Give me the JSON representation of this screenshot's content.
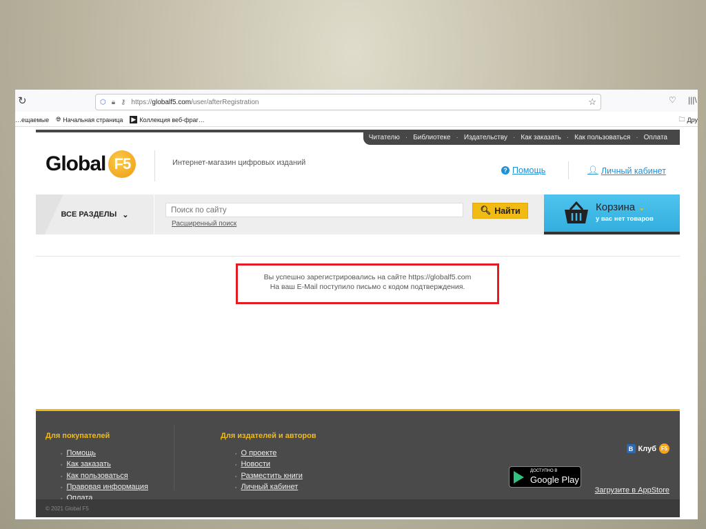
{
  "browser": {
    "url_prefix": "https://",
    "url_domain": "globalf5.com",
    "url_path": "/user/afterRegistration",
    "bookmarks": [
      "…ещаемые",
      "Начальная страница",
      "Коллекция веб-фраг…"
    ],
    "bookmarks_right": "Дру"
  },
  "topnav": [
    "Читателю",
    "Библиотеке",
    "Издательству",
    "Как заказать",
    "Как пользоваться",
    "Оплата"
  ],
  "header": {
    "logo_text": "Global",
    "logo_badge": "F5",
    "tagline": "Интернет-магазин цифровых изданий",
    "help": "Помощь",
    "account": "Личный кабинет"
  },
  "band": {
    "sections": "ВСЕ РАЗДЕЛЫ",
    "search_placeholder": "Поиск по сайту",
    "advanced": "Расширенный поиск",
    "find": "Найти",
    "cart_title": "Корзина",
    "cart_status": "у вас нет товаров"
  },
  "message": {
    "line1": "Вы успешно зарегистрировались на сайте https://globalf5.com",
    "line2": "На ваш E-Mail поступило письмо с кодом подтверждения."
  },
  "footer": {
    "buyers_title": "Для покупателей",
    "buyers": [
      "Помощь",
      "Как заказать",
      "Как пользоваться",
      "Правовая информация",
      "Оплата"
    ],
    "publishers_title": "Для издателей и авторов",
    "publishers": [
      "О проекте",
      "Новости",
      "Разместить книги",
      "Личный кабинет"
    ],
    "club": "Клуб",
    "club_badge": "F5",
    "vk": "B",
    "gplay_small": "ДОСТУПНО В",
    "gplay_big": "Google Play",
    "appstore": "Загрузите в AppStore",
    "copyright": "© 2021 Global F5"
  },
  "colors": {
    "accent": "#f2bb13",
    "link": "#1f8fd6",
    "cart": "#3fb8e8",
    "highlight": "#e31b23"
  }
}
